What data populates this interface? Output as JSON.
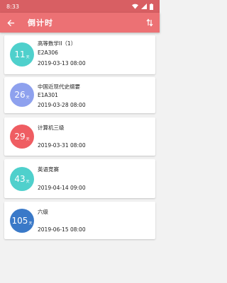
{
  "status_bar": {
    "time": "8:33"
  },
  "app_bar": {
    "title": "倒计时"
  },
  "colors": {
    "primary": "#ec7174",
    "status": "#d85f63"
  },
  "items": [
    {
      "days": "11",
      "unit": "天",
      "name": "高等数学II（1）",
      "room": "E2A306",
      "datetime": "2019-03-13 08:00",
      "color": "#4fd0cc"
    },
    {
      "days": "26",
      "unit": "天",
      "name": "中国近现代史纲要",
      "room": "E1A301",
      "datetime": "2019-03-28 08:00",
      "color": "#8ea1ee"
    },
    {
      "days": "29",
      "unit": "天",
      "name": "计算机三级",
      "room": "",
      "datetime": "2019-03-31 08:00",
      "color": "#ef5d62"
    },
    {
      "days": "43",
      "unit": "天",
      "name": "英语竞赛",
      "room": "",
      "datetime": "2019-04-14 09:00",
      "color": "#4fd0cc"
    },
    {
      "days": "105",
      "unit": "天",
      "name": "六级",
      "room": "",
      "datetime": "2019-06-15 08:00",
      "color": "#3a79c8"
    }
  ]
}
